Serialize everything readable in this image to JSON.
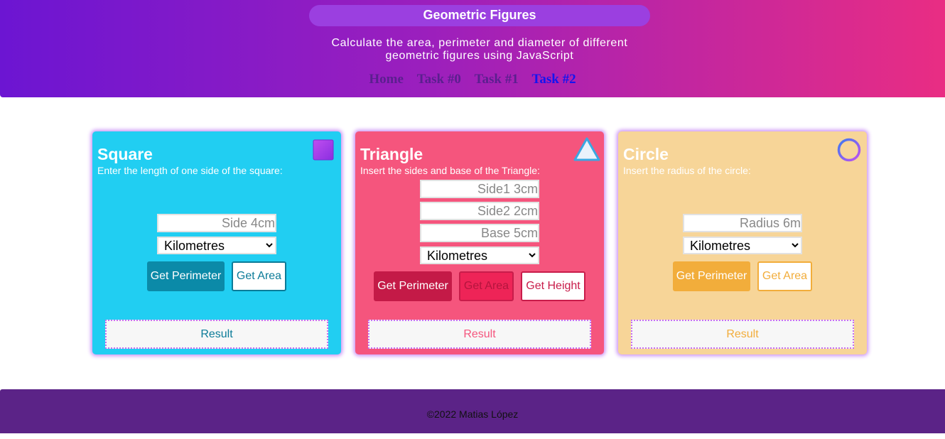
{
  "header": {
    "title": "Geometric Figures",
    "subtitle": "Calculate the area, perimeter and diameter of different geometric figures using JavaScript",
    "nav": [
      "Home",
      "Task #0",
      "Task #1",
      "Task #2"
    ],
    "active_nav": "Task #2"
  },
  "square": {
    "title": "Square",
    "description": "Enter the length of one side of the square:",
    "side_placeholder": "Side 4cm",
    "unit_selected": "Kilometres",
    "perimeter_button": "Get Perimeter",
    "area_button": "Get Area",
    "result": "Result",
    "icon": "square-icon",
    "color": "#21cef2"
  },
  "triangle": {
    "title": "Triangle",
    "description": "Insert the sides and base of the Triangle:",
    "side1_placeholder": "Side1 3cm",
    "side2_placeholder": "Side2 2cm",
    "base_placeholder": "Base 5cm",
    "unit_selected": "Kilometres",
    "perimeter_button": "Get Perimeter",
    "area_button": "Get Area",
    "height_button": "Get Height",
    "result": "Result",
    "icon": "triangle-icon",
    "color": "#f5557d"
  },
  "circle": {
    "title": "Circle",
    "description": "Insert the radius of the circle:",
    "radius_placeholder": "Radius 6m",
    "unit_selected": "Kilometres",
    "perimeter_button": "Get Perimeter",
    "area_button": "Get Area",
    "result": "Result",
    "icon": "circle-icon",
    "color": "#f7d598"
  },
  "footer": {
    "copyright": "©2022 Matias López"
  }
}
